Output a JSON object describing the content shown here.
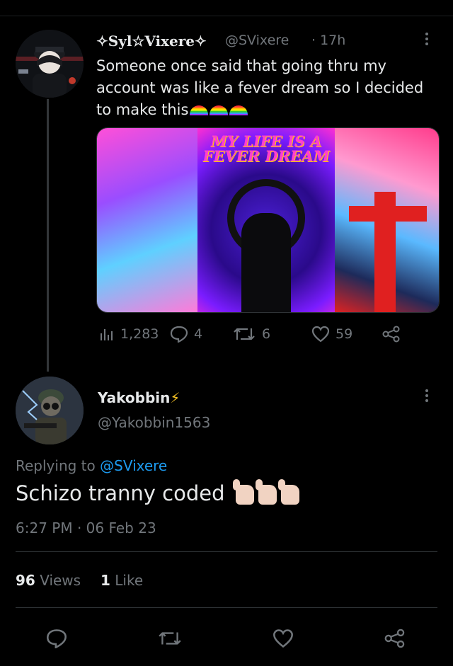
{
  "original_tweet": {
    "display_name": "✧Syl☆Vixere✧",
    "handle": "@SVixere",
    "time": "· 17h",
    "text": "Someone once said that going thru my account was like a fever dream so I decided to make this",
    "emoji": [
      "rainbow",
      "rainbow",
      "rainbow"
    ],
    "media_text": "MY LIFE IS A FEVER DREAM",
    "stats": {
      "views": "1,283",
      "replies": "4",
      "retweets": "6",
      "likes": "59"
    },
    "icons": [
      "analytics-icon",
      "reply-icon",
      "retweet-icon",
      "heart-icon",
      "share-icon",
      "more-icon"
    ]
  },
  "reply": {
    "display_name": "Yakobbin",
    "name_emoji": "⚡",
    "handle": "@Yakobbin1563",
    "replying_prefix": "Replying to",
    "replying_to": "@SVixere",
    "text": "Schizo tranny coded",
    "emoji": [
      "thumbs-up",
      "thumbs-up",
      "thumbs-up"
    ],
    "timestamp": "6:27 PM · 06 Feb 23",
    "views_count": "96",
    "views_label": "Views",
    "likes_count": "1",
    "likes_label": "Like"
  },
  "action_bar": [
    "reply-icon",
    "retweet-icon",
    "heart-icon",
    "share-icon"
  ],
  "colors": {
    "background": "#000000",
    "text": "#e7e9ea",
    "muted": "#71767b",
    "link": "#1d9bf0",
    "divider": "#2f3336"
  }
}
